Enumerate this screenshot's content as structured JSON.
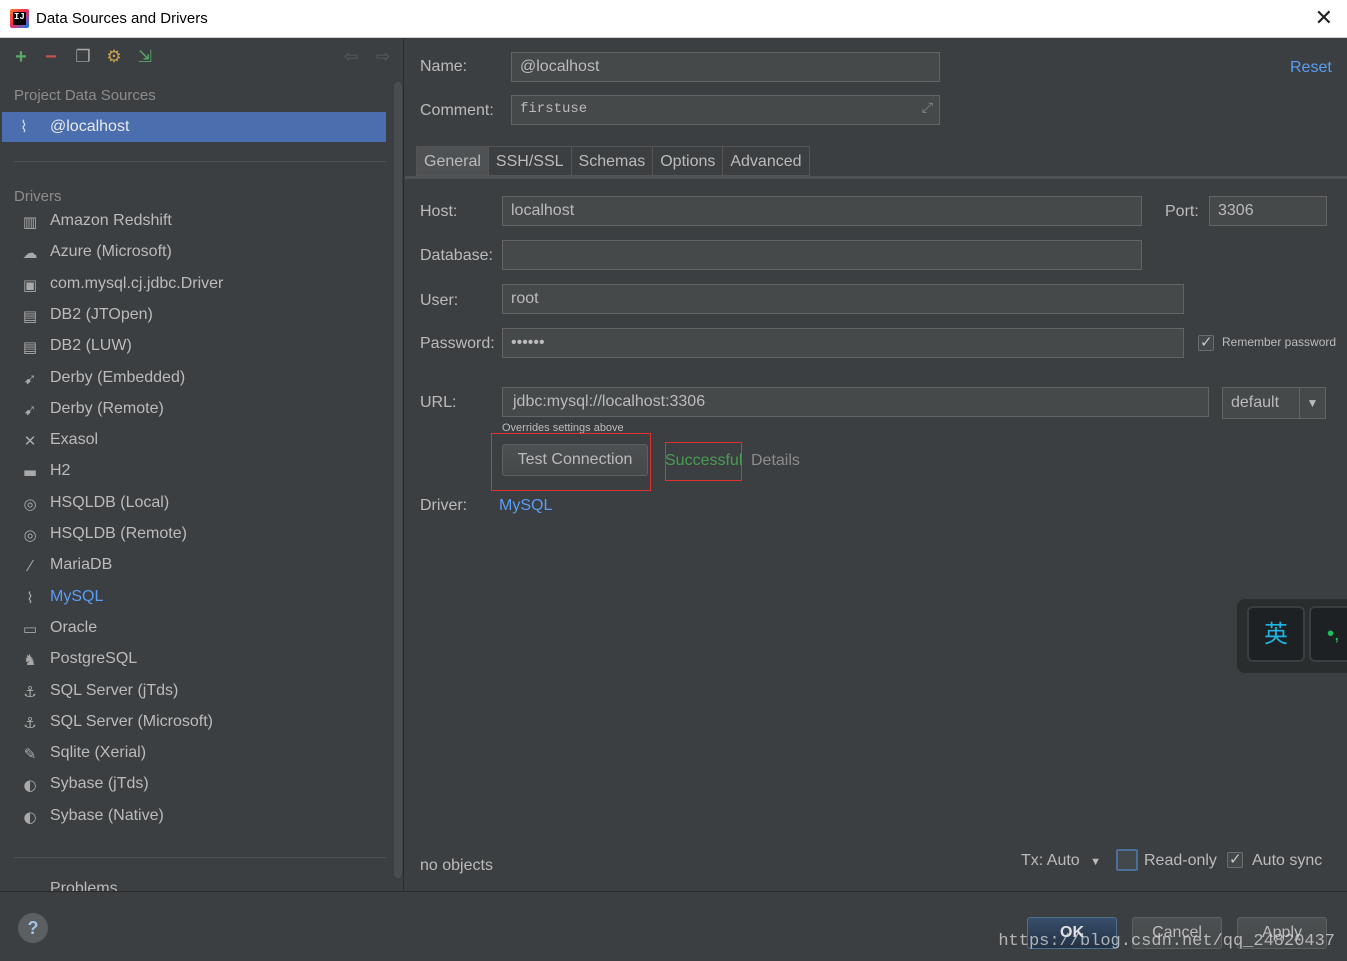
{
  "window": {
    "title": "Data Sources and Drivers"
  },
  "left": {
    "section_project": "Project Data Sources",
    "selected_source": "@localhost",
    "section_drivers": "Drivers",
    "drivers": [
      {
        "label": "Amazon Redshift",
        "icon": "redshift-icon",
        "glyph": "▥"
      },
      {
        "label": "Azure (Microsoft)",
        "icon": "azure-icon",
        "glyph": "☁"
      },
      {
        "label": "com.mysql.cj.jdbc.Driver",
        "icon": "driver-icon",
        "glyph": "▣"
      },
      {
        "label": "DB2 (JTOpen)",
        "icon": "ibm-db2-icon",
        "glyph": "▤"
      },
      {
        "label": "DB2 (LUW)",
        "icon": "ibm-db2-icon",
        "glyph": "▤"
      },
      {
        "label": "Derby (Embedded)",
        "icon": "derby-icon",
        "glyph": "➹"
      },
      {
        "label": "Derby (Remote)",
        "icon": "derby-icon",
        "glyph": "➹"
      },
      {
        "label": "Exasol",
        "icon": "exasol-icon",
        "glyph": "✕"
      },
      {
        "label": "H2",
        "icon": "h2-icon",
        "glyph": "▬"
      },
      {
        "label": "HSQLDB (Local)",
        "icon": "hsqldb-icon",
        "glyph": "◎"
      },
      {
        "label": "HSQLDB (Remote)",
        "icon": "hsqldb-icon",
        "glyph": "◎"
      },
      {
        "label": "MariaDB",
        "icon": "mariadb-icon",
        "glyph": "⁄"
      },
      {
        "label": "MySQL",
        "icon": "mysql-icon",
        "glyph": "⌇"
      },
      {
        "label": "Oracle",
        "icon": "oracle-icon",
        "glyph": "▭"
      },
      {
        "label": "PostgreSQL",
        "icon": "postgresql-icon",
        "glyph": "♞"
      },
      {
        "label": "SQL Server (jTds)",
        "icon": "sqlserver-icon",
        "glyph": "⚓"
      },
      {
        "label": "SQL Server (Microsoft)",
        "icon": "sqlserver-icon",
        "glyph": "⚓"
      },
      {
        "label": "Sqlite (Xerial)",
        "icon": "sqlite-icon",
        "glyph": "✎"
      },
      {
        "label": "Sybase (jTds)",
        "icon": "sybase-icon",
        "glyph": "◐"
      },
      {
        "label": "Sybase (Native)",
        "icon": "sybase-icon",
        "glyph": "◐"
      }
    ],
    "active_driver": "MySQL",
    "problems": "Problems"
  },
  "right": {
    "name_label": "Name:",
    "name_value": "@localhost",
    "reset": "Reset",
    "comment_label": "Comment:",
    "comment_value": "firstuse",
    "tabs": [
      "General",
      "SSH/SSL",
      "Schemas",
      "Options",
      "Advanced"
    ],
    "host_label": "Host:",
    "host_value": "localhost",
    "port_label": "Port:",
    "port_value": "3306",
    "database_label": "Database:",
    "database_value": "",
    "user_label": "User:",
    "user_value": "root",
    "password_label": "Password:",
    "password_value": "••••••",
    "remember_password": "Remember password",
    "url_label": "URL:",
    "url_value": "jdbc:mysql://localhost:3306",
    "url_mode": "default",
    "url_hint": "Overrides settings above",
    "test_connection": "Test Connection",
    "test_result": "Successful",
    "details": "Details",
    "driver_label": "Driver:",
    "driver_value": "MySQL",
    "status": "no objects",
    "tx": "Tx: Auto",
    "read_only": "Read-only",
    "auto_sync": "Auto sync"
  },
  "buttons": {
    "ok": "OK",
    "cancel": "Cancel",
    "apply": "Apply",
    "help": "?"
  },
  "ime": {
    "mode": "英",
    "punct": "•,"
  },
  "watermark": "https://blog.csdn.net/qq_24820437",
  "colors": {
    "accent": "#4b6eaf",
    "link": "#589df6",
    "success": "#499c54",
    "highlight_box": "#e03030"
  }
}
